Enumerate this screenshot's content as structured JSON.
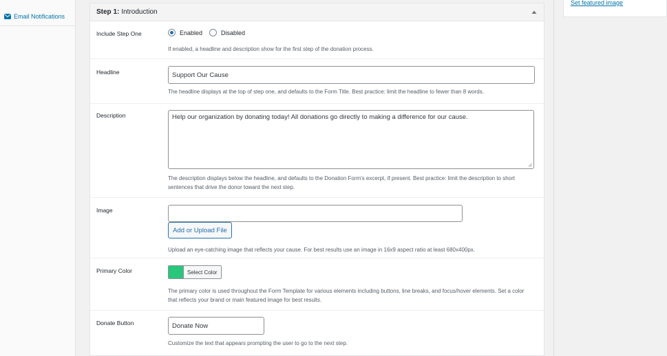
{
  "left_tab": {
    "icon": "envelope-icon",
    "label": "Email Notifications"
  },
  "panel": {
    "step_label": "Step 1:",
    "title": "Introduction"
  },
  "include_step": {
    "label": "Include Step One",
    "options": [
      "Enabled",
      "Disabled"
    ],
    "selected": "Enabled",
    "description": "If enabled, a headline and description show for the first step of the donation process."
  },
  "headline": {
    "label": "Headline",
    "value": "Support Our Cause",
    "description": "The headline displays at the top of step one, and defaults to the Form Title. Best practice: limit the headline to fewer than 8 words."
  },
  "description_field": {
    "label": "Description",
    "value": "Help our organization by donating today! All donations go directly to making a difference for our cause.",
    "description": "The description displays below the headline, and defaults to the Donation Form's excerpt, if present. Best practice: limit the description to short sentences that drive the donor toward the next step."
  },
  "image": {
    "label": "Image",
    "value": "",
    "button": "Add or Upload File",
    "description": "Upload an eye-catching image that reflects your cause. For best results use an image in 16x9 aspect ratio at least 680x400px."
  },
  "primary_color": {
    "label": "Primary Color",
    "color": "#28c77b",
    "button": "Select Color",
    "description": "The primary color is used throughout the Form Template for various elements including buttons, line breaks, and focus/hover elements. Set a color that reflects your brand or main featured image for best results."
  },
  "donate_button": {
    "label": "Donate Button",
    "value": "Donate Now",
    "description": "Customize the text that appears prompting the user to go to the next step."
  },
  "sidebar": {
    "featured_image_link": "Set featured image"
  }
}
